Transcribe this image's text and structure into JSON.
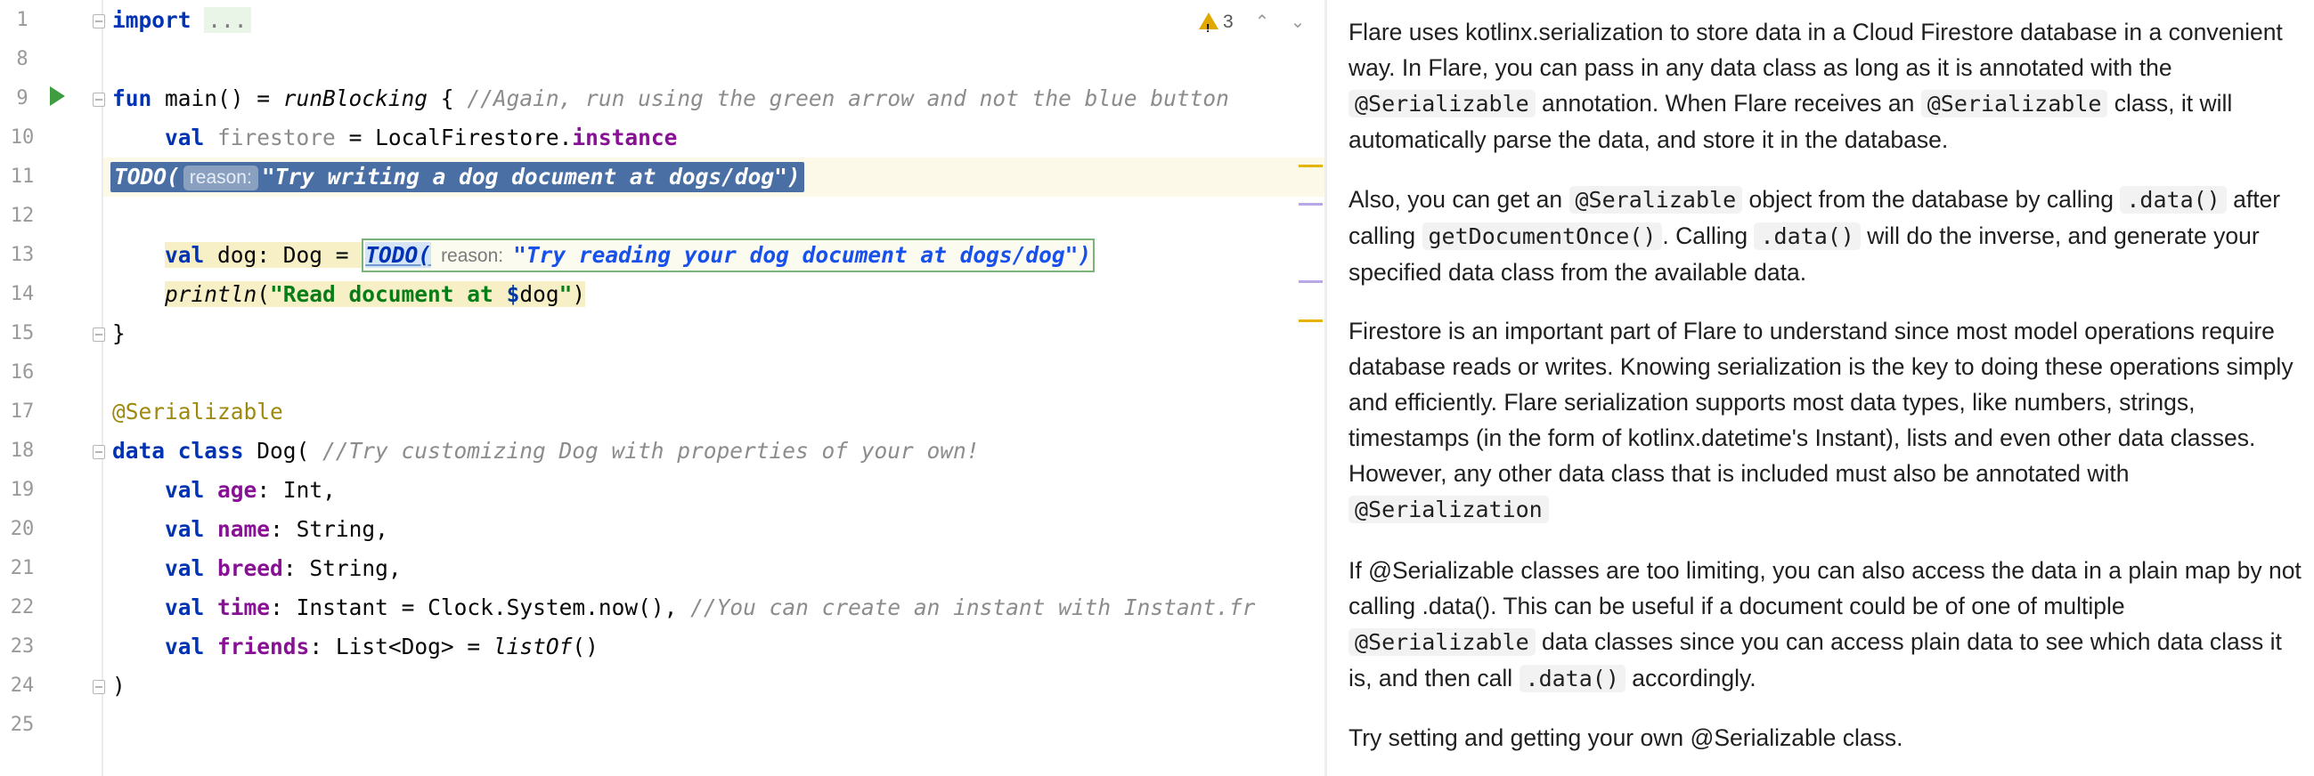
{
  "editor": {
    "line_numbers": [
      "1",
      "8",
      "9",
      "10",
      "11",
      "12",
      "13",
      "14",
      "15",
      "16",
      "17",
      "18",
      "19",
      "20",
      "21",
      "22",
      "23",
      "24",
      "25"
    ],
    "warnings_count": "3",
    "icons": {
      "warning": "warning-triangle-icon",
      "run": "run-gutter-icon",
      "prev": "chevron-up-icon",
      "next": "chevron-down-icon"
    },
    "code": {
      "l1_kw": "import",
      "l1_fold": "...",
      "l9_kw": "fun",
      "l9_a": " main() = ",
      "l9_fn": "runBlocking",
      "l9_b": " { ",
      "l9_cm": "//Again, run using the green arrow and not the blue button",
      "l10_kw": "val",
      "l10_var": "firestore",
      "l10_a": " = LocalFirestore.",
      "l10_prop": "instance",
      "l11_todo": "TODO(",
      "l11_hint": "reason:",
      "l11_str": "\"Try writing a dog document at dogs/dog\")",
      "l13_kw": "val",
      "l13_a": " dog: Dog = ",
      "l13_todo": "TODO(",
      "l13_hint": "reason:",
      "l13_str": "\"Try reading your dog document at dogs/dog\")",
      "l14_fn": "println",
      "l14_a": "(",
      "l14_str1": "\"Read document at ",
      "l14_dollar": "$",
      "l14_var": "dog",
      "l14_str2": "\"",
      "l14_b": ")",
      "l15": "}",
      "l17_ann": "@Serializable",
      "l18_kw": "data class",
      "l18_a": " Dog( ",
      "l18_cm": "//Try customizing Dog with properties of your own!",
      "l19_kw": "val",
      "l19_prop": "age",
      "l19_a": ": Int,",
      "l20_kw": "val",
      "l20_prop": "name",
      "l20_a": ": String,",
      "l21_kw": "val",
      "l21_prop": "breed",
      "l21_a": ": String,",
      "l22_kw": "val",
      "l22_prop": "time",
      "l22_a": ": Instant = Clock.System.now(), ",
      "l22_cm": "//You can create an instant with Instant.fr",
      "l23_kw": "val",
      "l23_prop": "friends",
      "l23_a": ": List<Dog> = ",
      "l23_fn": "listOf",
      "l23_b": "()",
      "l24": ")"
    }
  },
  "doc": {
    "p1_a": "Flare uses kotlinx.serialization to store data in a Cloud Firestore database in a convenient way. In Flare, you can pass in any data class as long as it is annotated with the ",
    "p1_code1": "@Serializable",
    "p1_b": " annotation. When Flare receives an ",
    "p1_code2": "@Serializable",
    "p1_c": " class, it will automatically parse the data, and store it in the database.",
    "p2_a": "Also, you can get an ",
    "p2_code1": "@Seralizable",
    "p2_b": " object from the database by calling ",
    "p2_code2": ".data()",
    "p2_c": " after calling ",
    "p2_code3": "getDocumentOnce()",
    "p2_d": ". Calling ",
    "p2_code4": ".data()",
    "p2_e": " will do the inverse, and generate your specified data class from the available data.",
    "p3_a": "Firestore is an important part of Flare to understand since most model operations require database reads or writes. Knowing serialization is the key to doing these operations simply and efficiently. Flare serialization supports most data types, like numbers, strings, timestamps (in the form of kotlinx.datetime's Instant), lists and even other data classes. However, any other data class that is included must also be annotated with ",
    "p3_code1": "@Serialization",
    "p4_a": "If @Serializable classes are too limiting, you can also access the data in a plain map by not calling .data(). This can be useful if a document could be of one of multiple ",
    "p4_code1": "@Serializable",
    "p4_b": " data classes since you can access plain data to see which data class it is, and then call ",
    "p4_code2": ".data()",
    "p4_c": " accordingly.",
    "p5": "Try setting and getting your own @Serializable class."
  }
}
